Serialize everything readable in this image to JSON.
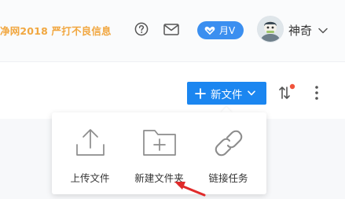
{
  "header": {
    "notice": "净网2018 严打不良信息",
    "vip_label": "月V",
    "username": "神奇"
  },
  "toolbar": {
    "new_file_label": "新文件"
  },
  "new_menu": {
    "items": [
      {
        "label": "上传文件",
        "icon": "upload-icon"
      },
      {
        "label": "新建文件夹",
        "icon": "new-folder-icon"
      },
      {
        "label": "链接任务",
        "icon": "link-icon"
      }
    ]
  },
  "colors": {
    "accent": "#1b86f0",
    "notice": "#f1a740",
    "badge": "#3b8ff0",
    "notification_dot": "#f0533b",
    "annotation_arrow": "#e02a2a"
  }
}
